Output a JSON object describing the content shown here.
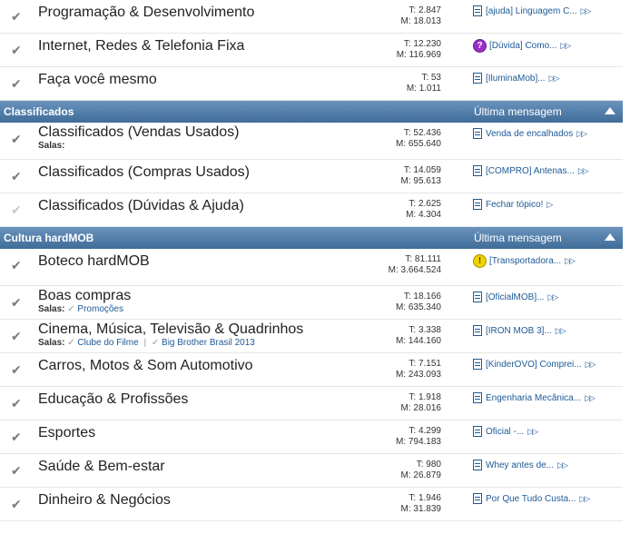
{
  "top_rows": [
    {
      "title": "Programação & Desenvolvimento",
      "topics": "T: 2.847",
      "messages": "M: 18.013",
      "last": "[ajuda] Linguagem C...",
      "badge": ""
    },
    {
      "title": "Internet, Redes & Telefonia Fixa",
      "topics": "T: 12.230",
      "messages": "M: 116.969",
      "last": "[Dúvida] Como...",
      "badge": "purple"
    },
    {
      "title": "Faça você mesmo",
      "topics": "T: 53",
      "messages": "M: 1.011",
      "last": "[IluminaMob]...",
      "badge": ""
    }
  ],
  "classificados": {
    "header": "Classificados",
    "last_header": "Última mensagem",
    "rows": [
      {
        "title": "Classificados (Vendas Usados)",
        "sub_label": "Salas:",
        "topics": "T: 52.436",
        "messages": "M: 655.640",
        "last": "Venda de encalhados"
      },
      {
        "title": "Classificados (Compras Usados)",
        "topics": "T: 14.059",
        "messages": "M: 95.613",
        "last": "[COMPRO] Antenas..."
      },
      {
        "title": "Classificados (Dúvidas & Ajuda)",
        "topics": "T: 2.625",
        "messages": "M: 4.304",
        "last": "Fechar tópico!"
      }
    ]
  },
  "cultura": {
    "header": "Cultura hardMOB",
    "last_header": "Última mensagem",
    "rows": [
      {
        "title": "Boteco hardMOB",
        "topics": "T: 81.111",
        "messages": "M: 3.664.524",
        "last": "[Transportadora...",
        "badge": "yellow"
      },
      {
        "title": "Boas compras",
        "sub_label": "Salas:",
        "sub_links": [
          "Promoções"
        ],
        "topics": "T: 18.166",
        "messages": "M: 635.340",
        "last": "[OficialMOB]..."
      },
      {
        "title": "Cinema, Música, Televisão & Quadrinhos",
        "sub_label": "Salas:",
        "sub_links": [
          "Clube do Filme",
          "Big Brother Brasil 2013"
        ],
        "topics": "T: 3.338",
        "messages": "M: 144.160",
        "last": "[IRON MOB 3]..."
      },
      {
        "title": "Carros, Motos & Som Automotivo",
        "topics": "T: 7.151",
        "messages": "M: 243.093",
        "last": "[KinderOVO] Comprei..."
      },
      {
        "title": "Educação & Profissões",
        "topics": "T: 1.918",
        "messages": "M: 28.016",
        "last": "Engenharia Mecânica..."
      },
      {
        "title": "Esportes",
        "topics": "T: 4.299",
        "messages": "M: 794.183",
        "last": "Oficial -..."
      },
      {
        "title": "Saúde & Bem-estar",
        "topics": "T: 980",
        "messages": "M: 26.879",
        "last": "Whey antes de..."
      },
      {
        "title": "Dinheiro & Negócios",
        "topics": "T: 1.946",
        "messages": "M: 31.839",
        "last": "Por Que Tudo Custa..."
      }
    ]
  },
  "colors": {
    "header_bg": "#4f7ba6",
    "link": "#1e5a96"
  }
}
